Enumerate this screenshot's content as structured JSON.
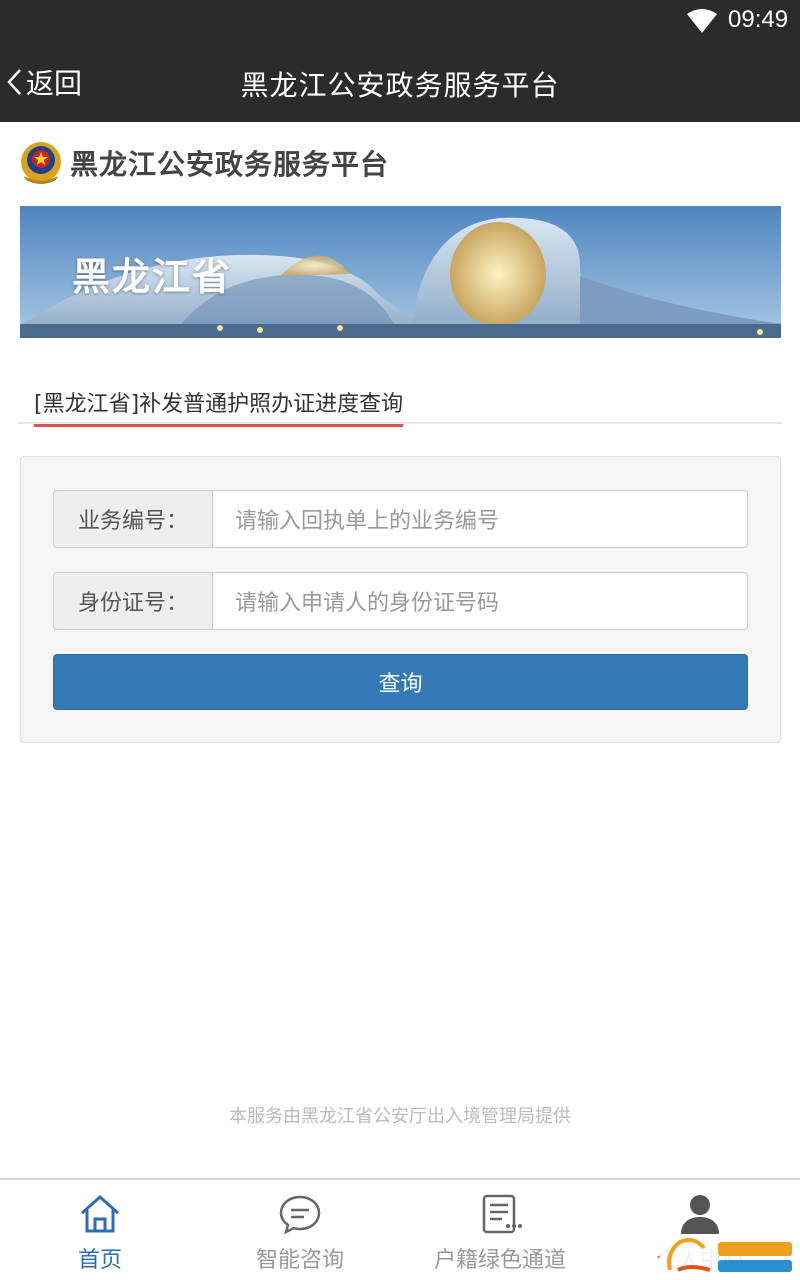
{
  "status_bar": {
    "time": "09:49"
  },
  "title_bar": {
    "back_label": "返回",
    "title": "黑龙江公安政务服务平台"
  },
  "brand": {
    "name": "黑龙江公安政务服务平台"
  },
  "banner": {
    "text": "黑龙江省"
  },
  "section": {
    "tab_label": "[黑龙江省]补发普通护照办证进度查询"
  },
  "form": {
    "business_no_label": "业务编号：",
    "business_no_placeholder": "请输入回执单上的业务编号",
    "id_no_label": "身份证号：",
    "id_no_placeholder": "请输入申请人的身份证号码",
    "query_label": "查询"
  },
  "footer": {
    "note": "本服务由黑龙江省公安厅出入境管理局提供"
  },
  "nav": {
    "items": [
      {
        "label": "首页",
        "icon": "home-icon",
        "active": true
      },
      {
        "label": "智能咨询",
        "icon": "chat-icon",
        "active": false
      },
      {
        "label": "户籍绿色通道",
        "icon": "document-icon",
        "active": false
      },
      {
        "label": "个人中心",
        "icon": "user-icon",
        "active": false
      }
    ]
  },
  "colors": {
    "accent": "#337ab7",
    "tab_underline": "#d9534f",
    "nav_active": "#2c6bb5"
  }
}
